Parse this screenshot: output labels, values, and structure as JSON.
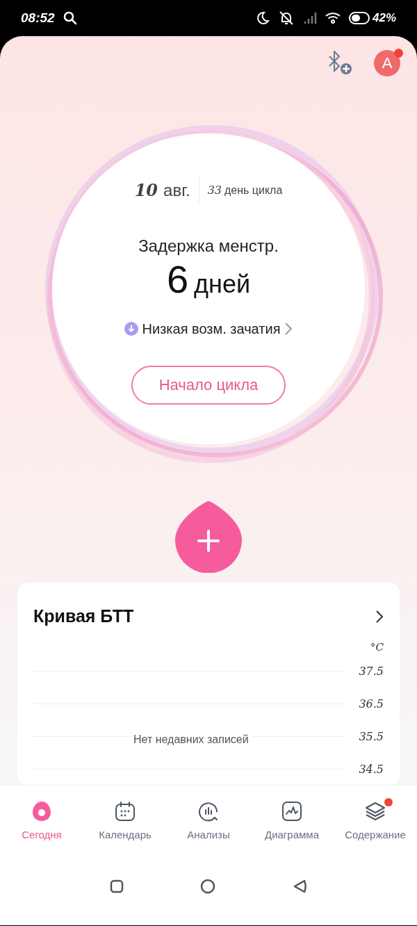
{
  "status_bar": {
    "time": "08:52",
    "battery": "42%"
  },
  "header": {
    "avatar_letter": "A",
    "avatar_badge": true
  },
  "cycle": {
    "day": "10",
    "month": "авг.",
    "cycle_day_number": "33",
    "cycle_day_label": "день цикла",
    "title": "Задержка менстр.",
    "days_number": "6",
    "days_label": "дней",
    "fertility": "Низкая возм. зачатия",
    "button": "Начало цикла"
  },
  "bbt_card": {
    "title": "Кривая БТТ",
    "unit": "°C",
    "ticks": [
      "37.5",
      "36.5",
      "35.5",
      "34.5"
    ],
    "empty_text": "Нет недавних записей"
  },
  "tabs": [
    {
      "label": "Сегодня",
      "kind": "today",
      "selected": true,
      "badge": false
    },
    {
      "label": "Календарь",
      "kind": "calendar",
      "selected": false,
      "badge": false
    },
    {
      "label": "Анализы",
      "kind": "analysis",
      "selected": false,
      "badge": false
    },
    {
      "label": "Диаграмма",
      "kind": "chart",
      "selected": false,
      "badge": false
    },
    {
      "label": "Содержание",
      "kind": "layers",
      "selected": false,
      "badge": true
    }
  ]
}
